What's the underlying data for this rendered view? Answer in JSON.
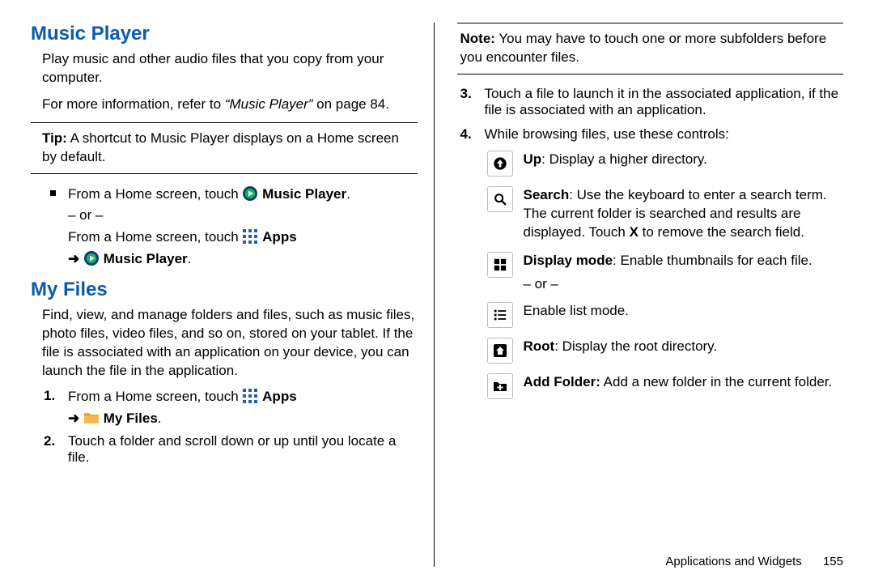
{
  "left": {
    "section1_title": "Music Player",
    "section1_p1": "Play music and other audio files that you copy from your computer.",
    "section1_p2_pre": "For more information, refer to ",
    "section1_p2_ref": "“Music Player”",
    "section1_p2_post": "  on page 84.",
    "tip_label": "Tip:",
    "tip_text": " A shortcut to Music Player displays on a Home screen by default.",
    "bullet_pre": "From a Home screen, touch ",
    "music_player_label": " Music Player",
    "or_label": "– or –",
    "bullet2_pre": "From a Home screen, touch ",
    "apps_label": " Apps",
    "arrow": "➜ ",
    "music_player_label2": " Music Player",
    "section2_title": "My Files",
    "section2_p1": "Find, view, and manage folders and files, such as music files, photo files, video files, and so on, stored on your tablet. If the file is associated with an application on your device, you can launch the file in the application.",
    "step1_num": "1.",
    "step1_pre": "From a Home screen, touch ",
    "step1_apps": " Apps",
    "step1_arrow": "➜ ",
    "my_files_label": " My Files",
    "step2_num": "2.",
    "step2_text": "Touch a folder and scroll down or up until you locate a file."
  },
  "right": {
    "note_label": "Note:",
    "note_text": " You may have to touch one or more subfolders before you encounter files.",
    "step3_num": "3.",
    "step3_text": "Touch a file to launch it in the associated application, if the file is associated with an application.",
    "step4_num": "4.",
    "step4_text": "While browsing files, use these controls:",
    "controls": [
      {
        "label": "Up",
        "desc": ": Display a higher directory."
      },
      {
        "label": "Search",
        "desc_pre": ": Use the keyboard to enter a search term. The current folder is searched and results are displayed. Touch ",
        "x": "X",
        "desc_post": " to remove the search field."
      },
      {
        "label": "Display mode",
        "desc": ": Enable thumbnails for each file.",
        "or": "– or –",
        "desc2": "Enable list mode."
      },
      {
        "label": "Root",
        "desc": ": Display the root directory."
      },
      {
        "label": "Add Folder:",
        "desc": " Add a new folder in the current folder."
      }
    ]
  },
  "footer": {
    "section": "Applications and Widgets",
    "page": "155"
  }
}
